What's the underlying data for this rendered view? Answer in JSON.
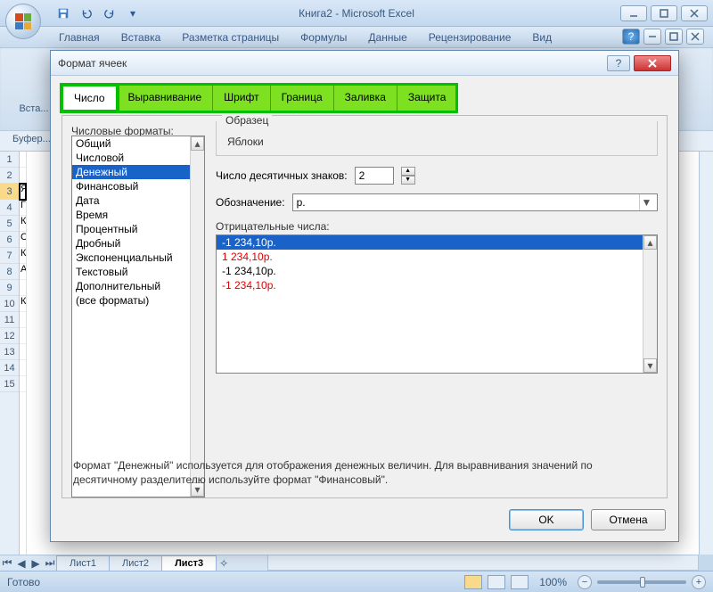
{
  "app": {
    "title": "Книга2 - Microsoft Excel"
  },
  "ribbon": {
    "tabs": [
      "Главная",
      "Вставка",
      "Разметка страницы",
      "Формулы",
      "Данные",
      "Рецензирование",
      "Вид"
    ],
    "section1": "Вста...",
    "section2": "Буфер..."
  },
  "grid": {
    "rows": [
      1,
      2,
      3,
      4,
      5,
      6,
      7,
      8,
      9,
      10,
      11,
      12,
      13,
      14,
      15
    ],
    "selected_row": 3,
    "colA": [
      "",
      "",
      "Я",
      "Г",
      "К",
      "С",
      "К",
      "А",
      "",
      "К",
      "",
      "",
      "",
      ""
    ]
  },
  "sheets": {
    "items": [
      "Лист1",
      "Лист2",
      "Лист3"
    ],
    "active": 2
  },
  "status": {
    "ready": "Готово",
    "zoom": "100%"
  },
  "dialog": {
    "title": "Формат ячеек",
    "tabs": [
      "Число",
      "Выравнивание",
      "Шрифт",
      "Граница",
      "Заливка",
      "Защита"
    ],
    "active_tab": 0,
    "formats_label": "Числовые форматы:",
    "formats": [
      "Общий",
      "Числовой",
      "Денежный",
      "Финансовый",
      "Дата",
      "Время",
      "Процентный",
      "Дробный",
      "Экспоненциальный",
      "Текстовый",
      "Дополнительный",
      "(все форматы)"
    ],
    "formats_selected": 2,
    "sample_label": "Образец",
    "sample_value": "Яблоки",
    "decimals_label": "Число десятичных знаков:",
    "decimals_value": "2",
    "symbol_label": "Обозначение:",
    "symbol_value": "р.",
    "negative_label": "Отрицательные числа:",
    "negative": [
      {
        "text": "-1 234,10р.",
        "red": false,
        "sel": true
      },
      {
        "text": "1 234,10р.",
        "red": true,
        "sel": false
      },
      {
        "text": "-1 234,10р.",
        "red": false,
        "sel": false
      },
      {
        "text": "-1 234,10р.",
        "red": true,
        "sel": false
      }
    ],
    "description": "Формат \"Денежный\" используется для отображения денежных величин. Для выравнивания значений по десятичному разделителю используйте формат \"Финансовый\".",
    "ok": "OK",
    "cancel": "Отмена"
  }
}
